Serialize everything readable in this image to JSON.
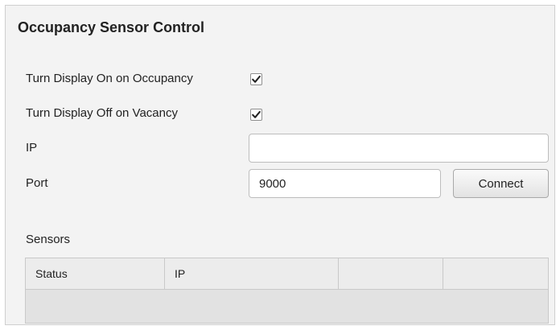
{
  "panel": {
    "title": "Occupancy Sensor Control"
  },
  "settings": {
    "display_on_label": "Turn Display On on Occupancy",
    "display_on_checked": true,
    "display_off_label": "Turn Display Off on Vacancy",
    "display_off_checked": true,
    "ip_label": "IP",
    "ip_value": "",
    "port_label": "Port",
    "port_value": "9000",
    "connect_label": "Connect"
  },
  "sensors": {
    "label": "Sensors",
    "columns": [
      "Status",
      "IP",
      "",
      ""
    ],
    "rows": []
  },
  "colors": {
    "panel_background": "#f3f3f3",
    "table_header": "#ececec",
    "table_body": "#e2e2e2"
  },
  "icons": {
    "checkbox": "checkmark-icon"
  }
}
